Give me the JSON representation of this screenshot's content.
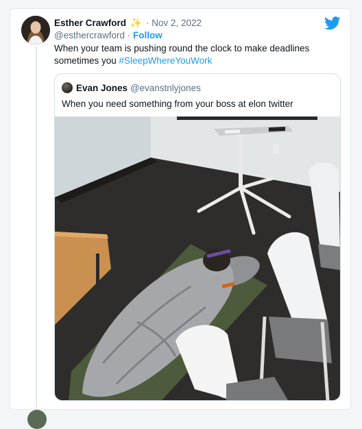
{
  "tweet": {
    "author_name": "Esther Crawford",
    "badge_emoji": "✨",
    "date_separator": " · ",
    "date": "Nov 2, 2022",
    "handle": "@esthercrawford",
    "follow_separator": " · ",
    "follow_label": "Follow",
    "text_line": "When your team is pushing round the clock to make deadlines sometimes you ",
    "hashtag": "#SleepWhereYouWork"
  },
  "quoted_tweet": {
    "author_name": "Evan Jones",
    "handle": "@evanstnlyjones",
    "text": "When you need something from your boss at elon twitter"
  },
  "icons": {
    "brand": "twitter-bird-icon",
    "brand_color": "#1d9bf0"
  }
}
